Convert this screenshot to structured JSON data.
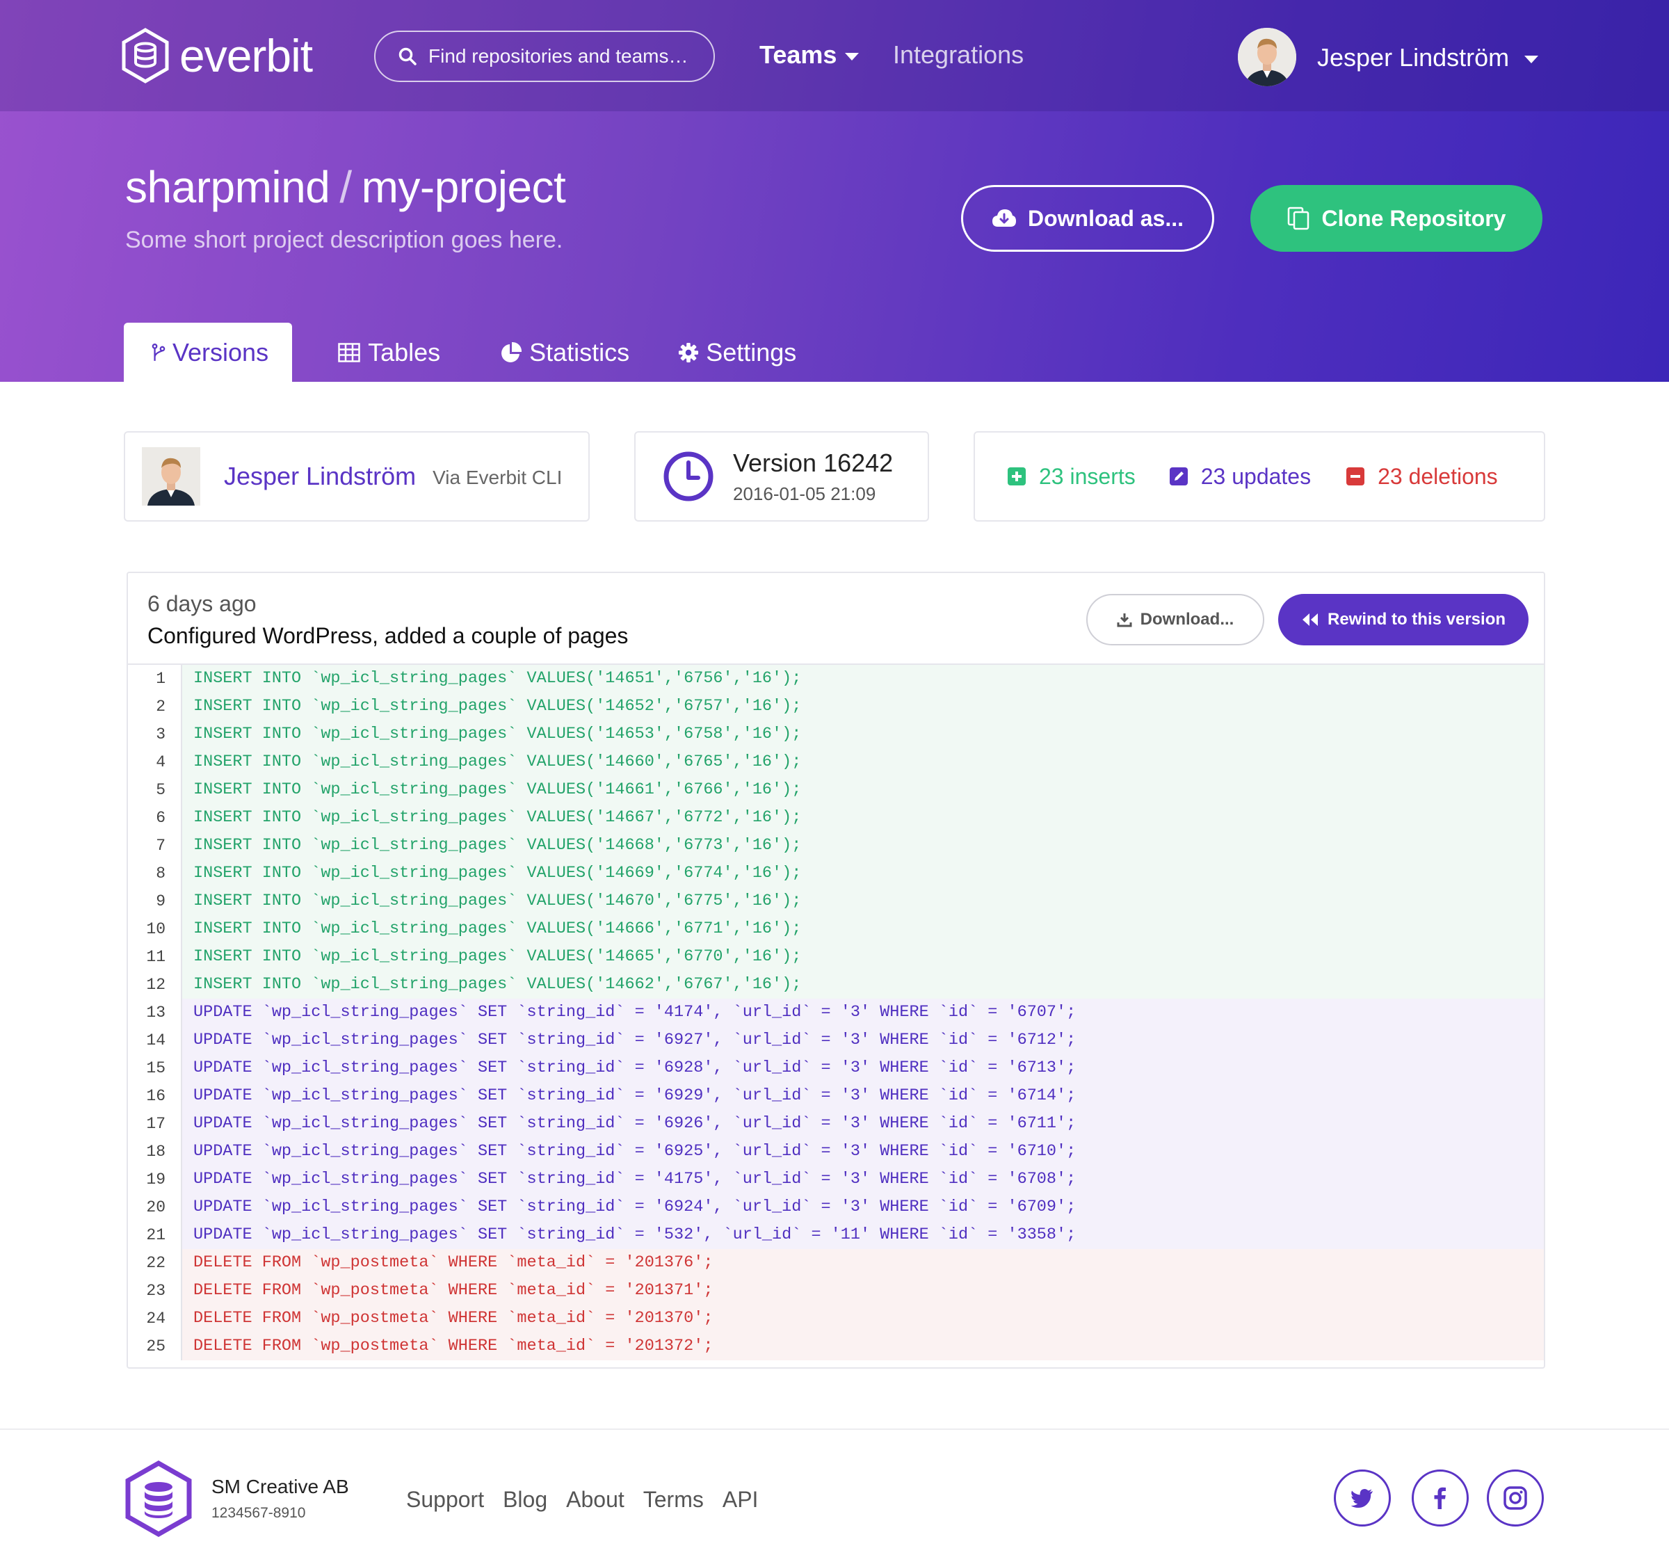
{
  "app": {
    "brand": "everbit"
  },
  "colors": {
    "accent": "#5a34c5",
    "success": "#2ec27e",
    "danger": "#d83a3a",
    "hero_start": "#9a52cf",
    "hero_end": "#3c26b8"
  },
  "header": {
    "search_placeholder": "Find repositories and teams…",
    "nav": {
      "teams": "Teams",
      "integrations": "Integrations"
    },
    "user": {
      "name": "Jesper Lindström"
    }
  },
  "repo": {
    "owner": "sharpmind",
    "separator": "/",
    "name": "my-project",
    "description": "Some short project description goes here.",
    "download_as_label": "Download as...",
    "clone_label": "Clone Repository"
  },
  "tabs": [
    {
      "label": "Versions",
      "icon": "branch-icon",
      "active": true
    },
    {
      "label": "Tables",
      "icon": "table-icon",
      "active": false
    },
    {
      "label": "Statistics",
      "icon": "pie-chart-icon",
      "active": false
    },
    {
      "label": "Settings",
      "icon": "gear-icon",
      "active": false
    }
  ],
  "version": {
    "author": "Jesper Lindström",
    "via": "Via Everbit CLI",
    "title": "Version 16242",
    "date": "2016-01-05 21:09",
    "inserts": "23 inserts",
    "updates": "23 updates",
    "deletions": "23 deletions"
  },
  "commit": {
    "when": "6 days ago",
    "message": "Configured WordPress, added a couple of pages",
    "download_label": "Download...",
    "rewind_label": "Rewind to this version"
  },
  "diff": [
    {
      "n": "1",
      "type": "insert",
      "text": "INSERT INTO `wp_icl_string_pages` VALUES('14651','6756','16');"
    },
    {
      "n": "2",
      "type": "insert",
      "text": "INSERT INTO `wp_icl_string_pages` VALUES('14652','6757','16');"
    },
    {
      "n": "3",
      "type": "insert",
      "text": "INSERT INTO `wp_icl_string_pages` VALUES('14653','6758','16');"
    },
    {
      "n": "4",
      "type": "insert",
      "text": "INSERT INTO `wp_icl_string_pages` VALUES('14660','6765','16');"
    },
    {
      "n": "5",
      "type": "insert",
      "text": "INSERT INTO `wp_icl_string_pages` VALUES('14661','6766','16');"
    },
    {
      "n": "6",
      "type": "insert",
      "text": "INSERT INTO `wp_icl_string_pages` VALUES('14667','6772','16');"
    },
    {
      "n": "7",
      "type": "insert",
      "text": "INSERT INTO `wp_icl_string_pages` VALUES('14668','6773','16');"
    },
    {
      "n": "8",
      "type": "insert",
      "text": "INSERT INTO `wp_icl_string_pages` VALUES('14669','6774','16');"
    },
    {
      "n": "9",
      "type": "insert",
      "text": "INSERT INTO `wp_icl_string_pages` VALUES('14670','6775','16');"
    },
    {
      "n": "10",
      "type": "insert",
      "text": "INSERT INTO `wp_icl_string_pages` VALUES('14666','6771','16');"
    },
    {
      "n": "11",
      "type": "insert",
      "text": "INSERT INTO `wp_icl_string_pages` VALUES('14665','6770','16');"
    },
    {
      "n": "12",
      "type": "insert",
      "text": "INSERT INTO `wp_icl_string_pages` VALUES('14662','6767','16');"
    },
    {
      "n": "13",
      "type": "update",
      "text": "UPDATE `wp_icl_string_pages` SET `string_id` = '4174', `url_id` = '3' WHERE `id` = '6707';"
    },
    {
      "n": "14",
      "type": "update",
      "text": "UPDATE `wp_icl_string_pages` SET `string_id` = '6927', `url_id` = '3' WHERE `id` = '6712';"
    },
    {
      "n": "15",
      "type": "update",
      "text": "UPDATE `wp_icl_string_pages` SET `string_id` = '6928', `url_id` = '3' WHERE `id` = '6713';"
    },
    {
      "n": "16",
      "type": "update",
      "text": "UPDATE `wp_icl_string_pages` SET `string_id` = '6929', `url_id` = '3' WHERE `id` = '6714';"
    },
    {
      "n": "17",
      "type": "update",
      "text": "UPDATE `wp_icl_string_pages` SET `string_id` = '6926', `url_id` = '3' WHERE `id` = '6711';"
    },
    {
      "n": "18",
      "type": "update",
      "text": "UPDATE `wp_icl_string_pages` SET `string_id` = '6925', `url_id` = '3' WHERE `id` = '6710';"
    },
    {
      "n": "19",
      "type": "update",
      "text": "UPDATE `wp_icl_string_pages` SET `string_id` = '4175', `url_id` = '3' WHERE `id` = '6708';"
    },
    {
      "n": "20",
      "type": "update",
      "text": "UPDATE `wp_icl_string_pages` SET `string_id` = '6924', `url_id` = '3' WHERE `id` = '6709';"
    },
    {
      "n": "21",
      "type": "update",
      "text": "UPDATE `wp_icl_string_pages` SET `string_id` = '532', `url_id` = '11' WHERE `id` = '3358';"
    },
    {
      "n": "22",
      "type": "delete",
      "text": "DELETE FROM `wp_postmeta` WHERE `meta_id` = '201376';"
    },
    {
      "n": "23",
      "type": "delete",
      "text": "DELETE FROM `wp_postmeta` WHERE `meta_id` = '201371';"
    },
    {
      "n": "24",
      "type": "delete",
      "text": "DELETE FROM `wp_postmeta` WHERE `meta_id` = '201370';"
    },
    {
      "n": "25",
      "type": "delete",
      "text": "DELETE FROM `wp_postmeta` WHERE `meta_id` = '201372';"
    }
  ],
  "footer": {
    "company": "SM Creative AB",
    "company_id": "1234567-8910",
    "links": [
      "Support",
      "Blog",
      "About",
      "Terms",
      "API"
    ],
    "social": [
      "twitter-icon",
      "facebook-icon",
      "instagram-icon"
    ]
  }
}
